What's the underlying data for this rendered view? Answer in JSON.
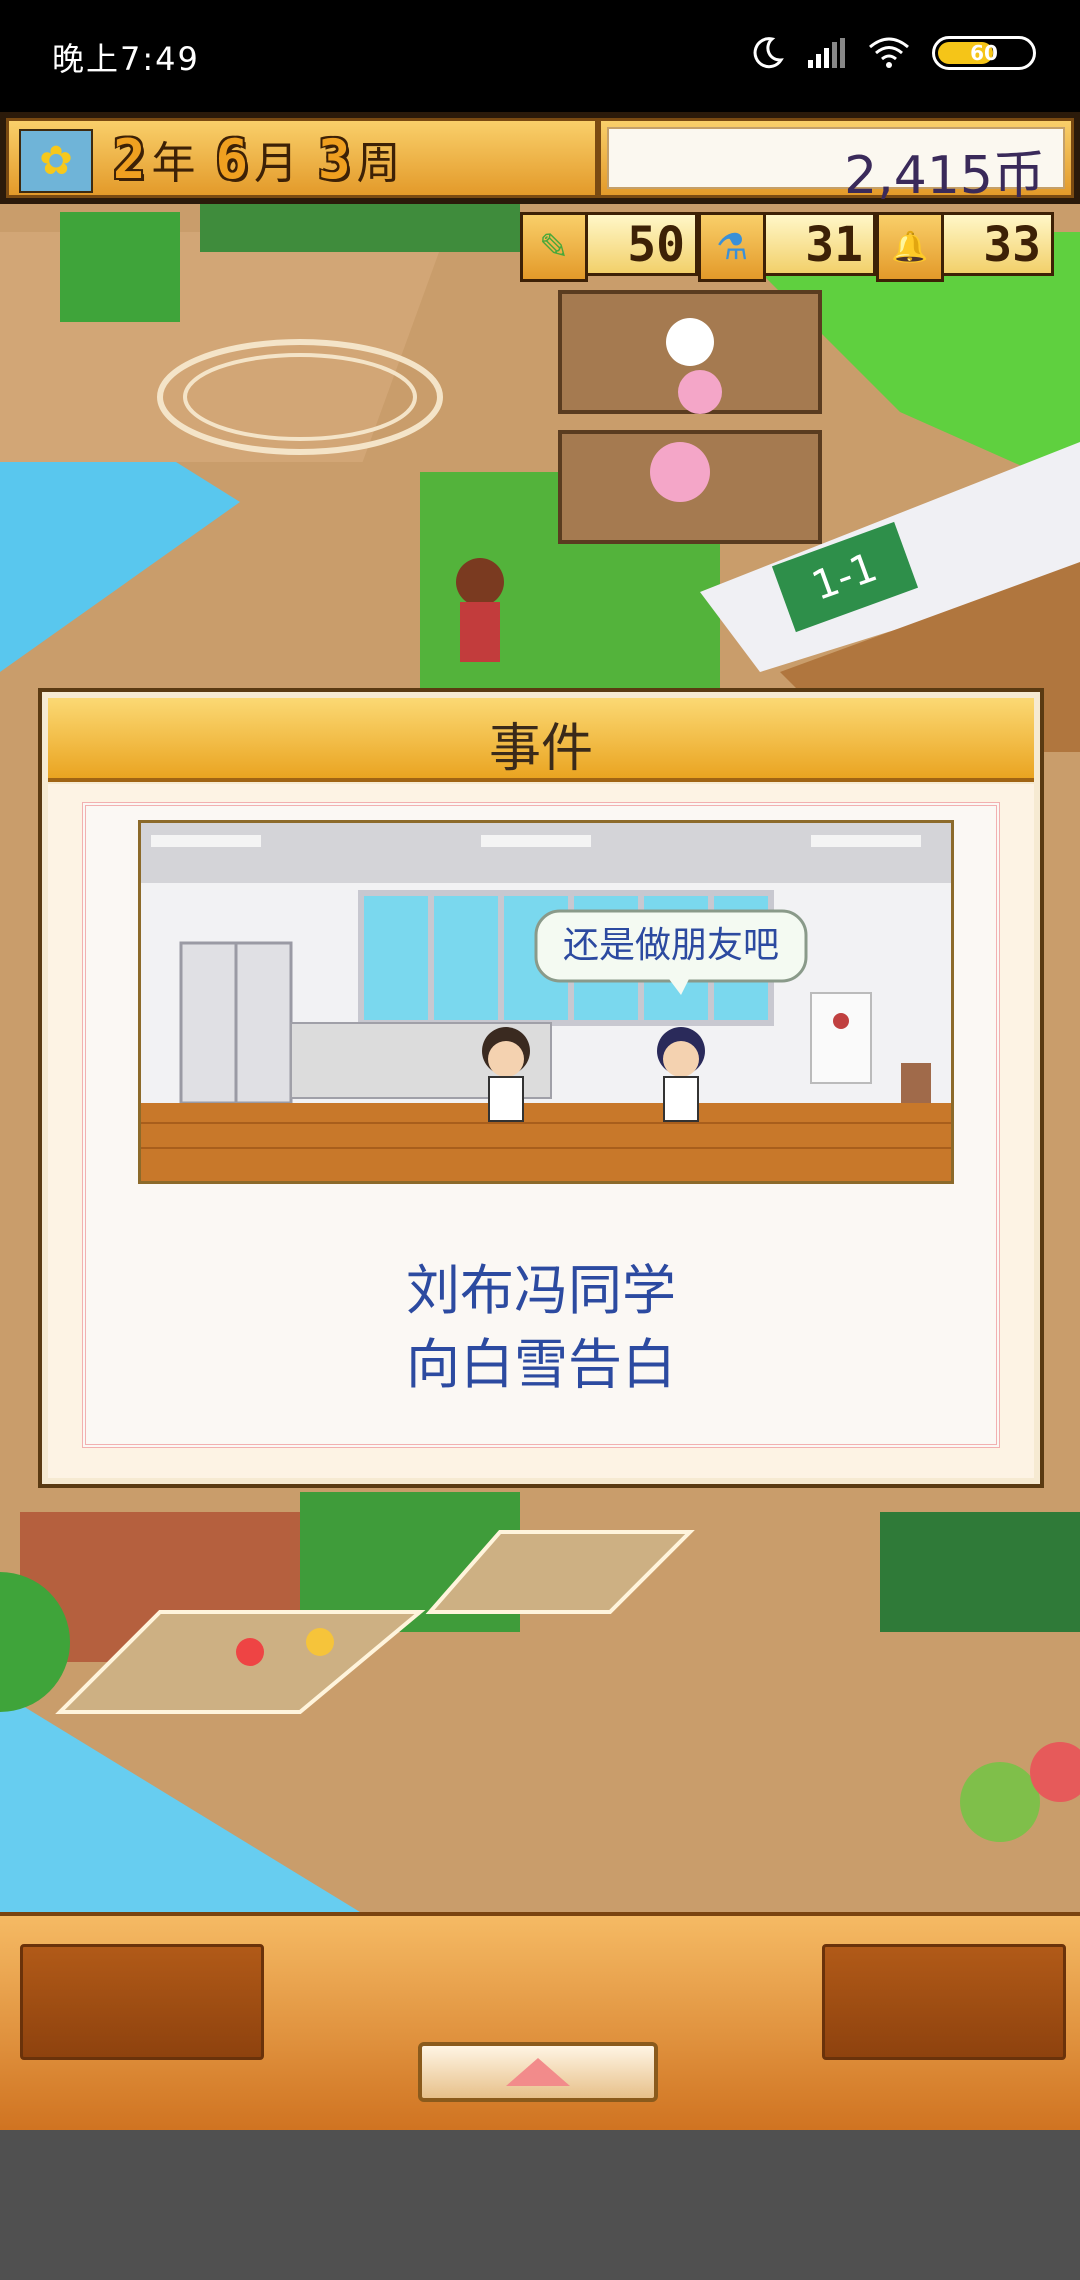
{
  "status_bar": {
    "time": "晚上7:49",
    "battery": "60"
  },
  "hud": {
    "year": "2",
    "year_unit": "年",
    "month": "6",
    "month_unit": "月",
    "week": "3",
    "week_unit": "周",
    "money": "2,415币",
    "stats": [
      {
        "icon": "pencil-icon",
        "glyph": "✎",
        "value": "50"
      },
      {
        "icon": "flask-icon",
        "glyph": "⚗",
        "value": "31"
      },
      {
        "icon": "bell-icon",
        "glyph": "🔔",
        "value": "33"
      }
    ]
  },
  "scene": {
    "classroom_sign": "1-1"
  },
  "dialog": {
    "title": "事件",
    "speech": "还是做朋友吧",
    "message_line1": "刘布冯同学",
    "message_line2": "向白雪告白"
  },
  "colors": {
    "accent": "#e7a02a",
    "text_blue": "#2c4aa0",
    "dark_brown": "#3d2106"
  }
}
